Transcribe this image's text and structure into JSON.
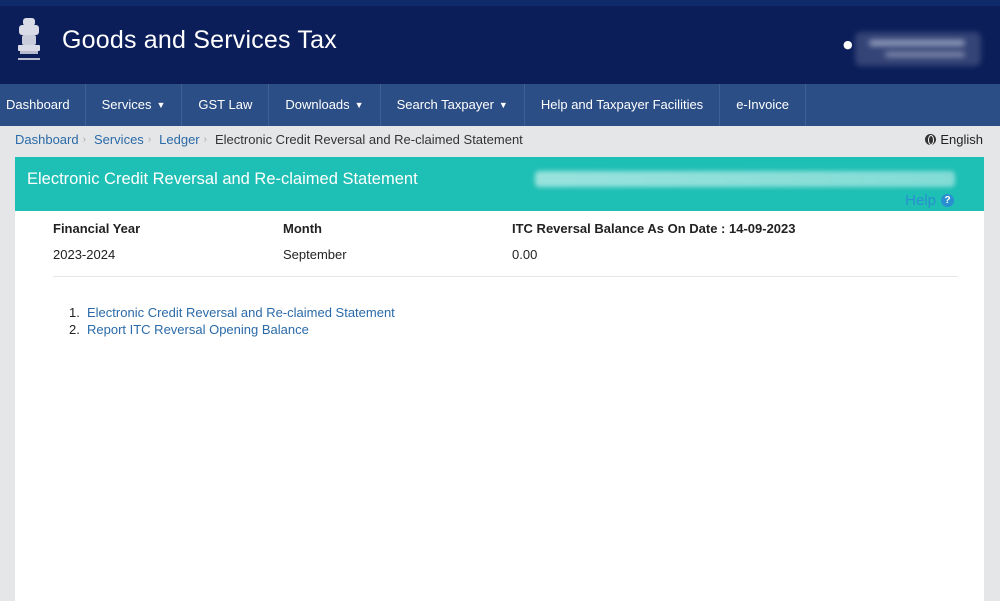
{
  "header": {
    "title": "Goods and Services Tax",
    "user_icon": "user-icon"
  },
  "nav": [
    {
      "label": "Dashboard",
      "has_caret": false
    },
    {
      "label": "Services",
      "has_caret": true
    },
    {
      "label": "GST Law",
      "has_caret": false
    },
    {
      "label": "Downloads",
      "has_caret": true
    },
    {
      "label": "Search Taxpayer",
      "has_caret": true
    },
    {
      "label": "Help and Taxpayer Facilities",
      "has_caret": false
    },
    {
      "label": "e-Invoice",
      "has_caret": false
    }
  ],
  "breadcrumb": {
    "items": [
      "Dashboard",
      "Services",
      "Ledger"
    ],
    "current": "Electronic Credit Reversal and Re-claimed Statement"
  },
  "language": "English",
  "panel": {
    "title": "Electronic Credit Reversal and Re-claimed Statement",
    "help_label": "Help"
  },
  "summary": {
    "fy_label": "Financial Year",
    "fy_value": "2023-2024",
    "month_label": "Month",
    "month_value": "September",
    "balance_label": "ITC Reversal Balance As On Date : 14-09-2023",
    "balance_value": "0.00"
  },
  "links": [
    {
      "num": "1.",
      "label": "Electronic Credit Reversal and Re-claimed Statement"
    },
    {
      "num": "2.",
      "label": "Report ITC Reversal Opening Balance"
    }
  ],
  "colors": {
    "header_bg": "#0b1e59",
    "nav_bg": "#2c4e86",
    "panel_head": "#1ebfb4",
    "link": "#2a6aa8"
  }
}
